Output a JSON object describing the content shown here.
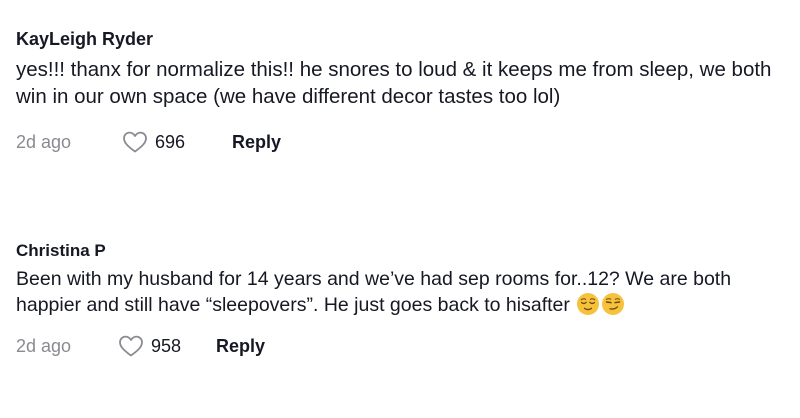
{
  "comments": [
    {
      "author": "KayLeigh Ryder",
      "text": "yes!!! thanx for normalize this!! he snores to loud & it keeps me from sleep, we both win in our own space (we have different decor tastes too lol)",
      "time": "2d ago",
      "likes": "696",
      "reply_label": "Reply",
      "like_icon": "heart-outline-icon"
    },
    {
      "author": "Christina P",
      "text": "Been with my husband for 14 years and we’ve had sep rooms for..12? We are both happier and still have “sleepovers”. He just goes back to hisafter",
      "emojis": [
        "relieved-face-icon",
        "smirking-face-icon"
      ],
      "time": "2d ago",
      "likes": "958",
      "reply_label": "Reply",
      "like_icon": "heart-outline-icon"
    }
  ],
  "colors": {
    "text": "#161823",
    "muted": "#8a8b91",
    "emoji_face": "#f7c23b"
  }
}
